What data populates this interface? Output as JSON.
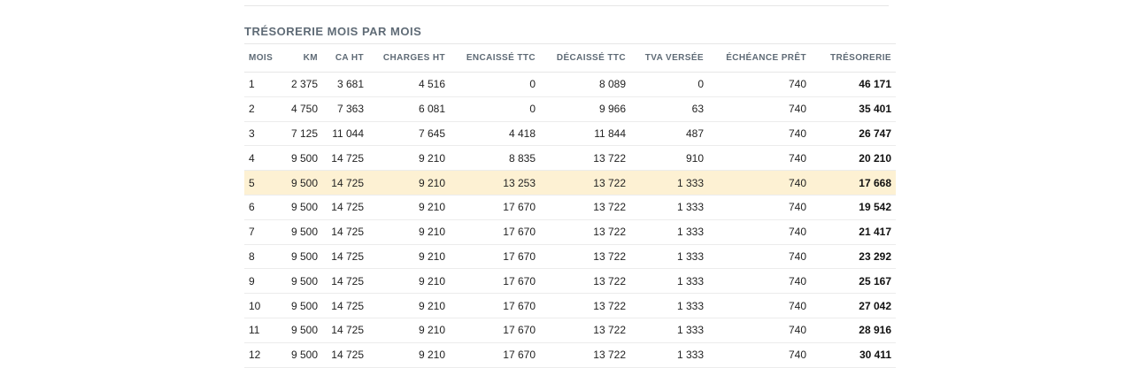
{
  "section": {
    "title": "TRÉSORERIE MOIS PAR MOIS"
  },
  "table": {
    "columns": [
      "MOIS",
      "KM",
      "CA HT",
      "CHARGES HT",
      "ENCAISSÉ TTC",
      "DÉCAISSÉ TTC",
      "TVA VERSÉE",
      "ÉCHÉANCE PRÊT",
      "TRÉSORERIE"
    ],
    "highlight_row_index": 4,
    "rows": [
      [
        "1",
        "2 375",
        "3 681",
        "4 516",
        "0",
        "8 089",
        "0",
        "740",
        "46 171"
      ],
      [
        "2",
        "4 750",
        "7 363",
        "6 081",
        "0",
        "9 966",
        "63",
        "740",
        "35 401"
      ],
      [
        "3",
        "7 125",
        "11 044",
        "7 645",
        "4 418",
        "11 844",
        "487",
        "740",
        "26 747"
      ],
      [
        "4",
        "9 500",
        "14 725",
        "9 210",
        "8 835",
        "13 722",
        "910",
        "740",
        "20 210"
      ],
      [
        "5",
        "9 500",
        "14 725",
        "9 210",
        "13 253",
        "13 722",
        "1 333",
        "740",
        "17 668"
      ],
      [
        "6",
        "9 500",
        "14 725",
        "9 210",
        "17 670",
        "13 722",
        "1 333",
        "740",
        "19 542"
      ],
      [
        "7",
        "9 500",
        "14 725",
        "9 210",
        "17 670",
        "13 722",
        "1 333",
        "740",
        "21 417"
      ],
      [
        "8",
        "9 500",
        "14 725",
        "9 210",
        "17 670",
        "13 722",
        "1 333",
        "740",
        "23 292"
      ],
      [
        "9",
        "9 500",
        "14 725",
        "9 210",
        "17 670",
        "13 722",
        "1 333",
        "740",
        "25 167"
      ],
      [
        "10",
        "9 500",
        "14 725",
        "9 210",
        "17 670",
        "13 722",
        "1 333",
        "740",
        "27 042"
      ],
      [
        "11",
        "9 500",
        "14 725",
        "9 210",
        "17 670",
        "13 722",
        "1 333",
        "740",
        "28 916"
      ],
      [
        "12",
        "9 500",
        "14 725",
        "9 210",
        "17 670",
        "13 722",
        "1 333",
        "740",
        "30 411"
      ]
    ]
  },
  "colors": {
    "highlight_row": "#fdf1d3",
    "header_text": "#5f6b76",
    "rule": "#e6e6e6"
  }
}
